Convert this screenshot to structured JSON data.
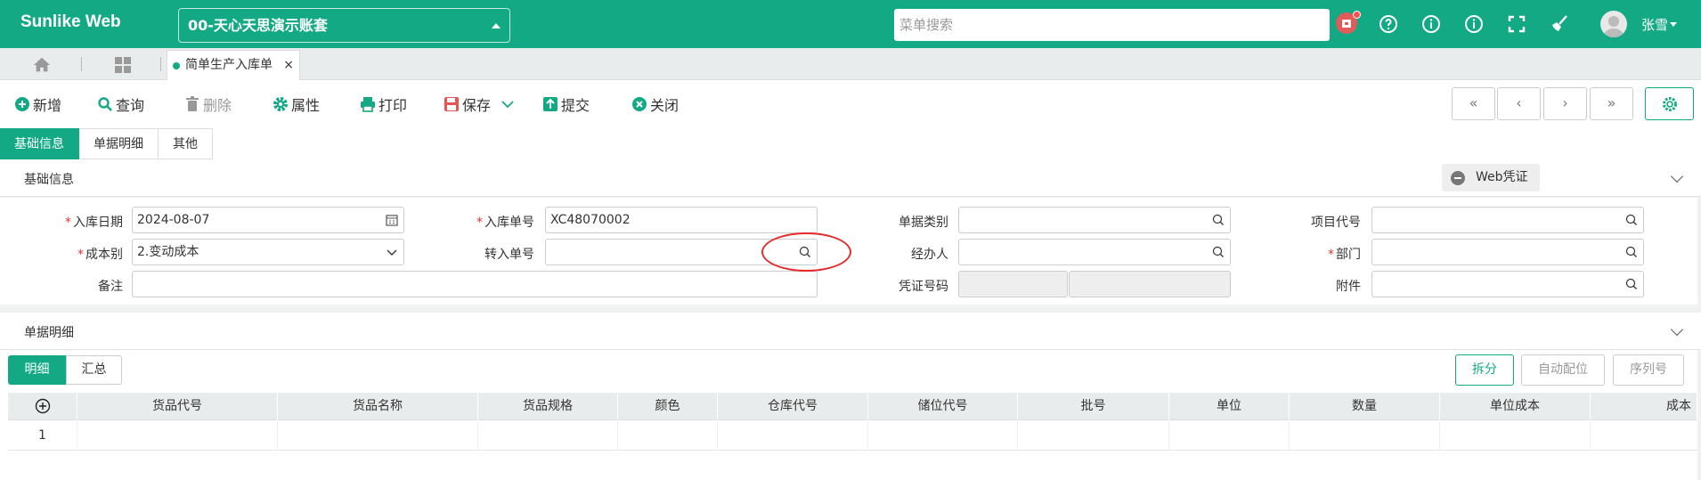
{
  "brand": "Sunlike Web",
  "account": "00-天心天思演示账套",
  "search": {
    "placeholder": "菜单搜索"
  },
  "user": "张雪",
  "tabs": [
    {
      "label": "简单生产入库单"
    }
  ],
  "toolbar": {
    "add": "新增",
    "query": "查询",
    "delete": "删除",
    "props": "属性",
    "print": "打印",
    "save": "保存",
    "submit": "提交",
    "close": "关闭"
  },
  "nav": [
    "«",
    "‹",
    "›",
    "»"
  ],
  "subtabs": [
    "基础信息",
    "单据明细",
    "其他"
  ],
  "section_basic": "基础信息",
  "web_voucher": "Web凭证",
  "form": {
    "in_date_label": "入库日期",
    "in_date": "2024-08-07",
    "in_no_label": "入库单号",
    "in_no": "XC48070002",
    "doc_type_label": "单据类别",
    "project_label": "项目代号",
    "cost_label": "成本别",
    "cost": "2.变动成本",
    "transfer_label": "转入单号",
    "handler_label": "经办人",
    "dept_label": "部门",
    "remark_label": "备注",
    "voucher_label": "凭证号码",
    "attach_label": "附件"
  },
  "section_detail": "单据明细",
  "detail_tabs": [
    "明细",
    "汇总"
  ],
  "detail_actions": [
    "拆分",
    "自动配位",
    "序列号"
  ],
  "grid": {
    "columns": [
      "货品代号",
      "货品名称",
      "货品规格",
      "颜色",
      "仓库代号",
      "储位代号",
      "批号",
      "单位",
      "数量",
      "单位成本",
      "成本"
    ],
    "rows": [
      {
        "no": "1"
      }
    ]
  },
  "colors": {
    "primary": "#12a984",
    "highlight": "#e52b2b"
  }
}
